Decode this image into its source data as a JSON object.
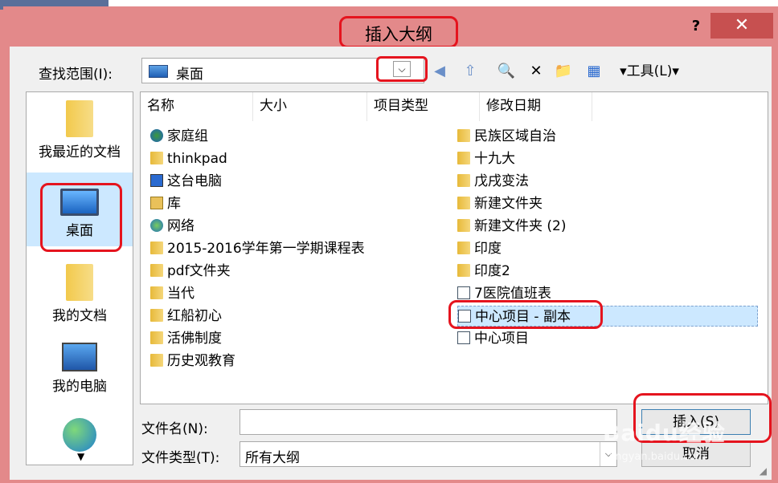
{
  "window": {
    "title": "插入大纲",
    "help": "?",
    "close": "✕"
  },
  "lookin": {
    "label": "查找范围(I):",
    "value": "桌面",
    "drop": "⌵"
  },
  "toolbar": {
    "back": "◀",
    "up": "⇧",
    "search": "🔍",
    "delete": "✕",
    "newfolder": "📁",
    "views": "▦",
    "tools": "▾工具(L)▾"
  },
  "places": [
    {
      "label": "我最近的文档",
      "icon": "folder"
    },
    {
      "label": "桌面",
      "icon": "monitor"
    },
    {
      "label": "我的文档",
      "icon": "folder"
    },
    {
      "label": "我的电脑",
      "icon": "pc"
    },
    {
      "label": "",
      "icon": "globe"
    }
  ],
  "columns": [
    "名称",
    "大小",
    "项目类型",
    "修改日期"
  ],
  "files_left": [
    {
      "name": "家庭组",
      "icon": "homegroup"
    },
    {
      "name": "thinkpad",
      "icon": "folder"
    },
    {
      "name": "这台电脑",
      "icon": "pc"
    },
    {
      "name": "库",
      "icon": "lib"
    },
    {
      "name": "网络",
      "icon": "net"
    },
    {
      "name": "2015-2016学年第一学期课程表",
      "icon": "folder"
    },
    {
      "name": "pdf文件夹",
      "icon": "folder"
    },
    {
      "name": "当代",
      "icon": "folder"
    },
    {
      "name": "红船初心",
      "icon": "folder"
    },
    {
      "name": "活佛制度",
      "icon": "folder"
    },
    {
      "name": "历史观教育",
      "icon": "folder"
    }
  ],
  "files_right": [
    {
      "name": "民族区域自治",
      "icon": "folder"
    },
    {
      "name": "十九大",
      "icon": "folder"
    },
    {
      "name": "戊戌变法",
      "icon": "folder"
    },
    {
      "name": "新建文件夹",
      "icon": "folder"
    },
    {
      "name": "新建文件夹 (2)",
      "icon": "folder"
    },
    {
      "name": "印度",
      "icon": "folder"
    },
    {
      "name": "印度2",
      "icon": "folder"
    },
    {
      "name": "7医院值班表",
      "icon": "doc"
    },
    {
      "name": "中心项目 - 副本",
      "icon": "doc",
      "selected": true
    },
    {
      "name": "中心项目",
      "icon": "doc"
    }
  ],
  "filename": {
    "label": "文件名(N):",
    "value": ""
  },
  "filetype": {
    "label": "文件类型(T):",
    "value": "所有大纲",
    "drop": "⌵"
  },
  "buttons": {
    "insert": "插入(S)",
    "cancel": "取消"
  },
  "watermark": {
    "main": "Baidu经验",
    "sub": "jingyan.baidu.com"
  }
}
